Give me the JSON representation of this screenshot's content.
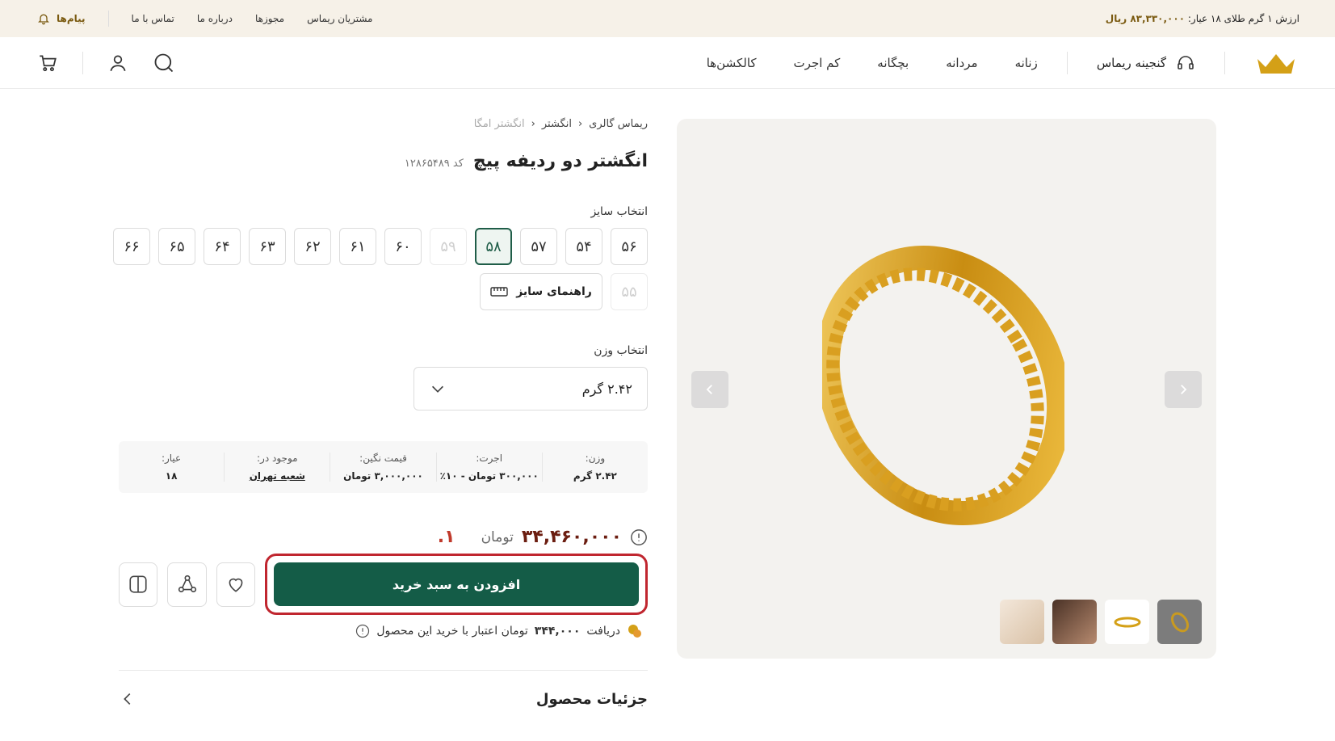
{
  "topbar": {
    "messages_label": "پیام‌ها",
    "links": [
      "تماس با ما",
      "درباره ما",
      "مجوزها",
      "مشتریان ریماس"
    ],
    "gold_price_label": "ارزش ۱ گرم طلای ۱۸ عیار:",
    "gold_price_value": "۸۳,۳۳۰,۰۰۰ ریال"
  },
  "nav": {
    "menu": [
      "کالکشن‌ها",
      "کم اجرت",
      "بچگانه",
      "مردانه",
      "زنانه"
    ],
    "treasury_label": "گنجینه ریماس"
  },
  "breadcrumb": [
    "ریماس گالری",
    "انگشتر",
    "انگشتر امگا"
  ],
  "product": {
    "title": "انگشتر دو ردیفه پیچ",
    "code": "کد ۱۲۸۶۵۴۸۹",
    "size_label": "انتخاب سایز",
    "sizes": [
      {
        "label": "۵۶",
        "state": "normal"
      },
      {
        "label": "۵۴",
        "state": "normal"
      },
      {
        "label": "۵۷",
        "state": "normal"
      },
      {
        "label": "۵۸",
        "state": "selected"
      },
      {
        "label": "۵۹",
        "state": "disabled"
      },
      {
        "label": "۶۰",
        "state": "normal"
      },
      {
        "label": "۶۱",
        "state": "normal"
      },
      {
        "label": "۶۲",
        "state": "normal"
      },
      {
        "label": "۶۳",
        "state": "normal"
      },
      {
        "label": "۶۴",
        "state": "normal"
      },
      {
        "label": "۶۵",
        "state": "normal"
      },
      {
        "label": "۶۶",
        "state": "normal"
      },
      {
        "label": "۵۵",
        "state": "disabled"
      }
    ],
    "size_guide_label": "راهنمای سایز",
    "weight_label": "انتخاب وزن",
    "weight_value": "۲.۴۲ گرم",
    "specs": [
      {
        "key": "وزن:",
        "value": "۲.۴۲ گرم",
        "link": false
      },
      {
        "key": "اجرت:",
        "value": "۳۰۰,۰۰۰ تومان - ۱۰٪",
        "link": false
      },
      {
        "key": "قیمت نگین:",
        "value": "۳,۰۰۰,۰۰۰ تومان",
        "link": false
      },
      {
        "key": "موجود در:",
        "value": "شعبه تهران",
        "link": true
      },
      {
        "key": "عیار:",
        "value": "۱۸",
        "link": false
      }
    ],
    "price": "۳۴,۴۶۰,۰۰۰",
    "currency": "تومان",
    "annotation_marker": "۱.",
    "add_to_cart_label": "افزودن به سبد خرید",
    "credit_text_1": "دریافت",
    "credit_amount": "۳۴۴,۰۰۰",
    "credit_text_2": "تومان اعتبار با خرید این محصول",
    "details_label": "جزئیات محصول"
  },
  "colors": {
    "brand_green": "#145c47",
    "price_brown": "#6b1d10",
    "gold": "#d4a017",
    "highlight_red": "#c0262f"
  }
}
